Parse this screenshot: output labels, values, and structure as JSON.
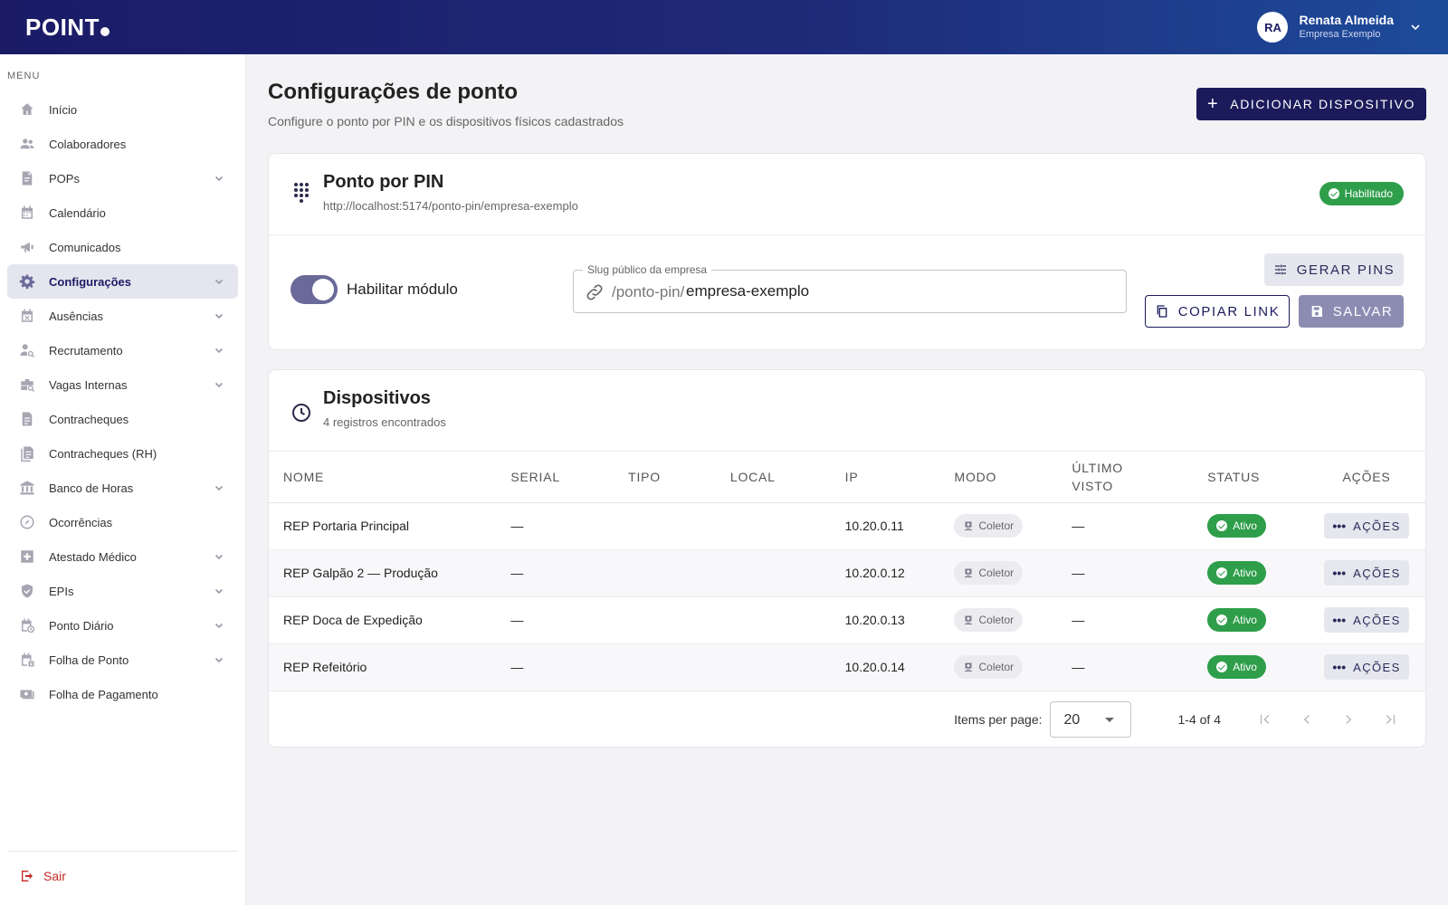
{
  "header": {
    "logo": "POINT",
    "user": {
      "initials": "RA",
      "name": "Renata Almeida",
      "company": "Empresa Exemplo"
    }
  },
  "sidebar": {
    "menu_label": "MENU",
    "items": [
      {
        "label": "Início",
        "icon": "home-icon",
        "has_chevron": false
      },
      {
        "label": "Colaboradores",
        "icon": "people-icon",
        "has_chevron": false
      },
      {
        "label": "POPs",
        "icon": "document-icon",
        "has_chevron": true
      },
      {
        "label": "Calendário",
        "icon": "calendar-icon",
        "has_chevron": false
      },
      {
        "label": "Comunicados",
        "icon": "megaphone-icon",
        "has_chevron": false
      },
      {
        "label": "Configurações",
        "icon": "gear-icon",
        "has_chevron": true,
        "active": true
      },
      {
        "label": "Ausências",
        "icon": "calendar-x-icon",
        "has_chevron": true
      },
      {
        "label": "Recrutamento",
        "icon": "person-search-icon",
        "has_chevron": true
      },
      {
        "label": "Vagas Internas",
        "icon": "briefcase-search-icon",
        "has_chevron": true
      },
      {
        "label": "Contracheques",
        "icon": "receipt-icon",
        "has_chevron": false
      },
      {
        "label": "Contracheques (RH)",
        "icon": "receipt-list-icon",
        "has_chevron": false
      },
      {
        "label": "Banco de Horas",
        "icon": "bank-icon",
        "has_chevron": true
      },
      {
        "label": "Ocorrências",
        "icon": "compass-icon",
        "has_chevron": false
      },
      {
        "label": "Atestado Médico",
        "icon": "medical-icon",
        "has_chevron": true
      },
      {
        "label": "EPIs",
        "icon": "shield-icon",
        "has_chevron": true
      },
      {
        "label": "Ponto Diário",
        "icon": "calendar-clock-icon",
        "has_chevron": true
      },
      {
        "label": "Folha de Ponto",
        "icon": "calendar-sheet-icon",
        "has_chevron": true
      },
      {
        "label": "Folha de Pagamento",
        "icon": "payments-icon",
        "has_chevron": false
      }
    ],
    "logout_label": "Sair"
  },
  "page": {
    "title": "Configurações de ponto",
    "subtitle": "Configure o ponto por PIN e os dispositivos físicos cadastrados",
    "add_device_label": "ADICIONAR DISPOSITIVO"
  },
  "pin_card": {
    "title": "Ponto por PIN",
    "url": "http://localhost:5174/ponto-pin/empresa-exemplo",
    "status_label": "Habilitado",
    "toggle_label": "Habilitar módulo",
    "toggle_on": true,
    "slug_legend": "Slug público da empresa",
    "slug_prefix": "/ponto-pin/",
    "slug_value": "empresa-exemplo",
    "generate_pins_label": "GERAR PINS",
    "copy_link_label": "COPIAR LINK",
    "save_label": "SALVAR"
  },
  "devices_card": {
    "title": "Dispositivos",
    "count_text": "4 registros encontrados",
    "columns": [
      "NOME",
      "SERIAL",
      "TIPO",
      "LOCAL",
      "IP",
      "MODO",
      "ÚLTIMO VISTO",
      "STATUS",
      "AÇÕES"
    ],
    "rows": [
      {
        "name": "REP Portaria Principal",
        "serial": "—",
        "type": "",
        "local": "",
        "ip": "10.20.0.11",
        "mode": "Coletor",
        "last_seen": "—",
        "status": "Ativo",
        "actions": "AÇÕES"
      },
      {
        "name": "REP Galpão 2 — Produção",
        "serial": "—",
        "type": "",
        "local": "",
        "ip": "10.20.0.12",
        "mode": "Coletor",
        "last_seen": "—",
        "status": "Ativo",
        "actions": "AÇÕES"
      },
      {
        "name": "REP Doca de Expedição",
        "serial": "—",
        "type": "",
        "local": "",
        "ip": "10.20.0.13",
        "mode": "Coletor",
        "last_seen": "—",
        "status": "Ativo",
        "actions": "AÇÕES"
      },
      {
        "name": "REP Refeitório",
        "serial": "—",
        "type": "",
        "local": "",
        "ip": "10.20.0.14",
        "mode": "Coletor",
        "last_seen": "—",
        "status": "Ativo",
        "actions": "AÇÕES"
      }
    ],
    "paginator": {
      "items_per_page_label": "Items per page:",
      "page_size": "20",
      "range": "1-4 of 4"
    }
  },
  "colors": {
    "brand": "#1b1b5c",
    "active_green": "#2e9e4a",
    "logout_red": "#c62828"
  }
}
